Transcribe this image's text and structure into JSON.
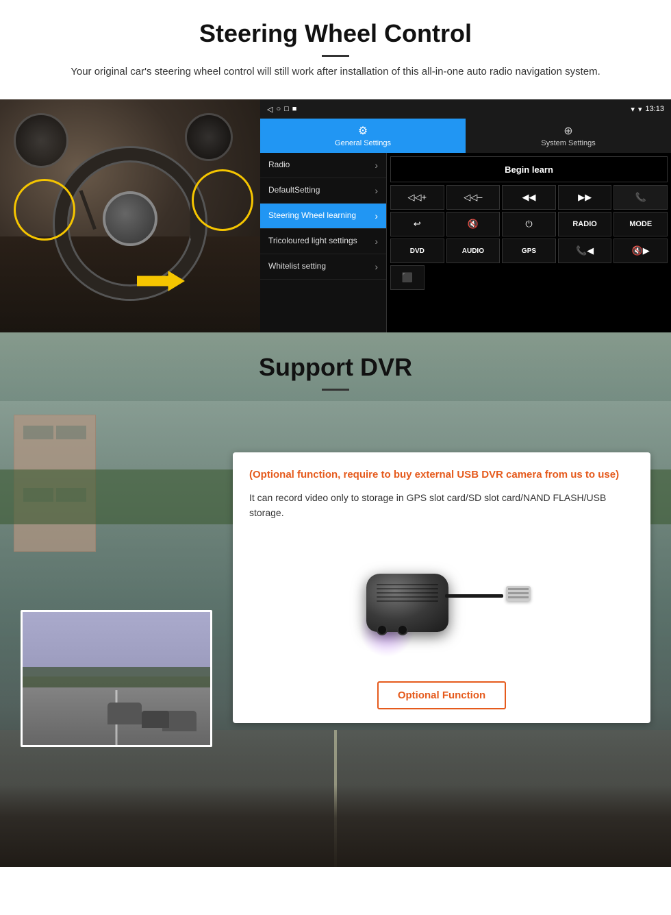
{
  "section1": {
    "title": "Steering Wheel Control",
    "subtitle": "Your original car's steering wheel control will still work after installation of this all-in-one auto radio navigation system.",
    "android_ui": {
      "status_bar": {
        "time": "13:13",
        "signal_icon": "▼",
        "wifi_icon": "▾"
      },
      "nav_icons": [
        "◁",
        "○",
        "□",
        "■"
      ],
      "tabs": [
        {
          "label": "General Settings",
          "icon": "⚙",
          "active": true
        },
        {
          "label": "System Settings",
          "icon": "🌐",
          "active": false
        }
      ],
      "menu_items": [
        {
          "label": "Radio",
          "active": false
        },
        {
          "label": "DefaultSetting",
          "active": false
        },
        {
          "label": "Steering Wheel learning",
          "active": true
        },
        {
          "label": "Tricoloured light settings",
          "active": false
        },
        {
          "label": "Whitelist setting",
          "active": false
        }
      ],
      "begin_learn": "Begin learn",
      "control_buttons_row1": [
        "◁◁+",
        "◁◁–",
        "◀◀",
        "▶▶",
        "☎"
      ],
      "control_buttons_row2": [
        "↩",
        "🔇",
        "⏻",
        "RADIO",
        "MODE"
      ],
      "control_buttons_row3": [
        "DVD",
        "AUDIO",
        "GPS",
        "☎◀◀",
        "🔇▶▶"
      ],
      "control_buttons_row4": [
        "⬛"
      ]
    }
  },
  "section2": {
    "title": "Support DVR",
    "optional_text": "(Optional function, require to buy external USB DVR camera from us to use)",
    "description": "It can record video only to storage in GPS slot card/SD slot card/NAND FLASH/USB storage.",
    "optional_function_label": "Optional Function"
  }
}
